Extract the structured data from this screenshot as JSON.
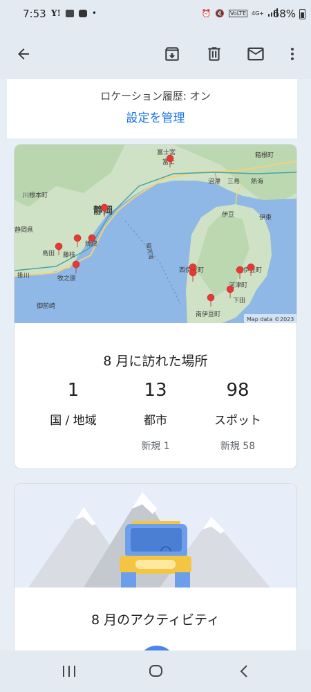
{
  "status_bar": {
    "time": "7:53",
    "left_icons": [
      "yahoo-icon",
      "gallery-icon",
      "youtube-icon",
      "dot-icon"
    ],
    "right_icons": [
      "alarm-icon",
      "mute-icon",
      "volte-icon",
      "4g-icon",
      "signal-icon"
    ],
    "battery": "68%",
    "network": "4G+"
  },
  "app_bar": {
    "icons": [
      "back-arrow-icon",
      "archive-icon",
      "delete-icon",
      "mail-icon",
      "more-vert-icon"
    ]
  },
  "location": {
    "history_label": "ロケーション履歴: オン",
    "manage_link": "設定を管理"
  },
  "map": {
    "attribution": "Map data ©2023",
    "labels": [
      "富士宮",
      "富士",
      "箱根町",
      "沼津",
      "三島",
      "熱海",
      "川根本町",
      "静岡",
      "伊豆",
      "伊東",
      "静岡県",
      "焼津",
      "藤枝",
      "駿河湾",
      "西伊豆町",
      "東伊豆町",
      "河津町",
      "掛川",
      "牧之原",
      "下田",
      "御前崎",
      "南伊豆町",
      "島田"
    ]
  },
  "visited": {
    "title": "8 月に訪れた場所",
    "stats": [
      {
        "value": "1",
        "label": "国 / 地域",
        "new": ""
      },
      {
        "value": "13",
        "label": "都市",
        "new": "新規 1"
      },
      {
        "value": "98",
        "label": "スポット",
        "new": "新規 58"
      }
    ]
  },
  "activity": {
    "title": "8 月のアクティビティ"
  },
  "nav_bar": {
    "icons": [
      "recent-apps-icon",
      "home-icon",
      "back-icon"
    ]
  },
  "colors": {
    "accent": "#1a73e8",
    "app_bar_bg": "#e3eaf2",
    "map_water": "#8fb8e6",
    "map_land": "#cfe2c5",
    "marker": "#e53935",
    "car": "#6d9eeb",
    "car_accent": "#f4c542"
  }
}
